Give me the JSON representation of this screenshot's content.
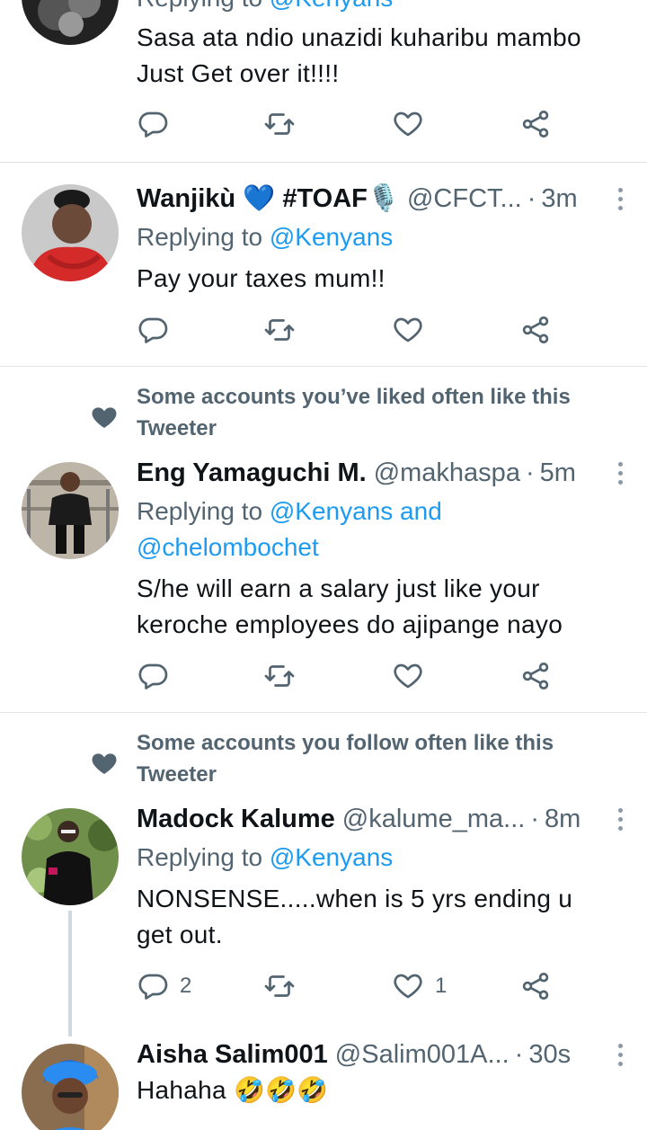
{
  "tweets": [
    {
      "replying_prefix": "Replying to",
      "replying_mentions": "@Kenyans",
      "text_line1": "Sasa ata ndio unazidi kuharibu mambo",
      "text_line2": "Just Get over it!!!!"
    },
    {
      "name": "Wanjikù 💙 #TOAF🎙️",
      "handle": "@CFCT...",
      "time": "3m",
      "replying_prefix": "Replying to",
      "replying_mentions": "@Kenyans",
      "text": "Pay your taxes mum!!"
    },
    {
      "social_context": "Some accounts you’ve liked often like this Tweeter",
      "name": "Eng Yamaguchi M.",
      "handle": "@makhaspa",
      "time": "5m",
      "replying_prefix": "Replying to",
      "replying_mentions_line1": "@Kenyans and",
      "replying_mentions_line2": "@chelombochet",
      "text_line1": "S/he will earn a salary just like your",
      "text_line2": "keroche employees do ajipange nayo"
    },
    {
      "social_context": "Some accounts you follow often like this Tweeter",
      "name": "Madock Kalume",
      "handle": "@kalume_ma...",
      "time": "8m",
      "replying_prefix": "Replying to",
      "replying_mentions": "@Kenyans",
      "text_line1": "NONSENSE.....when is 5 yrs ending u",
      "text_line2": "get out.",
      "reply_count": "2",
      "like_count": "1"
    },
    {
      "name": "Aisha Salim001",
      "handle": "@Salim001A...",
      "time": "30s",
      "text": "Hahaha 🤣🤣🤣"
    }
  ],
  "separator": "·",
  "icons": {
    "reply": "reply-icon",
    "retweet": "retweet-icon",
    "like": "heart-icon",
    "share": "share-icon",
    "more": "more-vertical-icon",
    "social_context": "heart-icon"
  },
  "colors": {
    "accent": "#1d9bf0",
    "muted": "#536471",
    "text": "#0f1419"
  }
}
